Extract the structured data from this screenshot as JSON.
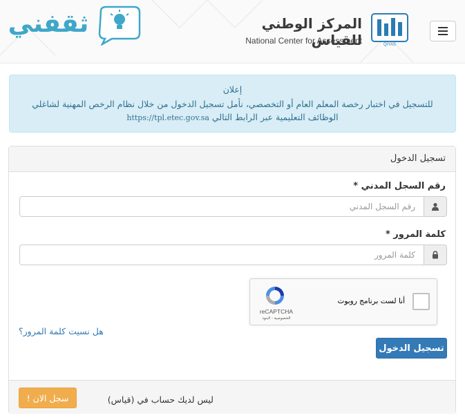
{
  "header": {
    "brand_ar": "المركز الوطني للقياس",
    "brand_en": "National Center for Assessment",
    "logo_caption": "QIYAS",
    "site_logo_text": "ثقفني"
  },
  "alert": {
    "title": "إعلان",
    "line1": "للتسجيل في اختبار رخصة المعلم العام أو التخصصي، نأمل تسجيل الدخول من خلال نظام الرخص المهنية لشاغلي",
    "line2": "الوظائف التعليمية عبر الرابط التالي",
    "link": "https://tpl.etec.gov.sa"
  },
  "login": {
    "heading": "تسجيل الدخول",
    "id_label": "رقم السجل المدني *",
    "id_placeholder": "رقم السجل المدني",
    "password_label": "كلمة المرور *",
    "password_placeholder": "كلمة المرور",
    "recaptcha_label": "أنا لست برنامج روبوت",
    "recaptcha_brand": "reCAPTCHA",
    "recaptcha_terms": "الخصوصية - البنود",
    "forgot_link": "هل نسيت كلمة المرور؟",
    "submit_label": "تسجيل الدخول"
  },
  "footer": {
    "no_account_text": "ليس لديك حساب في (قياس)",
    "register_label": "سجل الان !"
  },
  "colors": {
    "primary": "#337ab7",
    "warning": "#f0ad4e",
    "info_bg": "#d9edf7",
    "info_text": "#31708f"
  }
}
